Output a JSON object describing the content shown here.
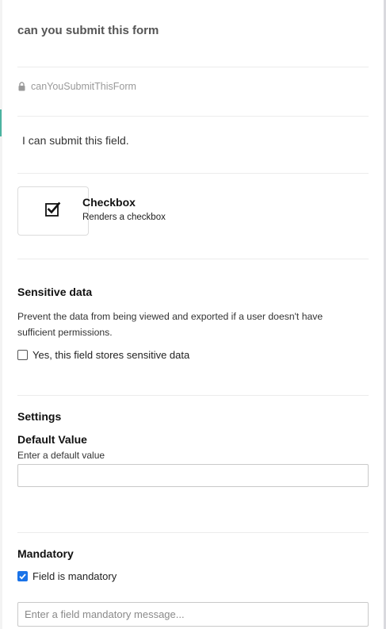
{
  "field": {
    "title": "can you submit this form",
    "key": "canYouSubmitThisForm",
    "label": "I can submit this field."
  },
  "type_card": {
    "icon": "checkbox-icon",
    "name": "Checkbox",
    "description": "Renders a checkbox"
  },
  "sensitive": {
    "heading": "Sensitive data",
    "description": "Prevent the data from being viewed and exported if a user doesn't have sufficient permissions.",
    "checkbox_label": "Yes, this field stores sensitive data",
    "checked": false
  },
  "settings": {
    "heading": "Settings",
    "default_value_label": "Default Value",
    "default_value_hint": "Enter a default value",
    "default_value": ""
  },
  "mandatory": {
    "heading": "Mandatory",
    "checkbox_label": "Field is mandatory",
    "checked": true,
    "message_placeholder": "Enter a field mandatory message..."
  },
  "colors": {
    "accent": "#1a73e8",
    "strip_accent": "#4bb3a0"
  }
}
